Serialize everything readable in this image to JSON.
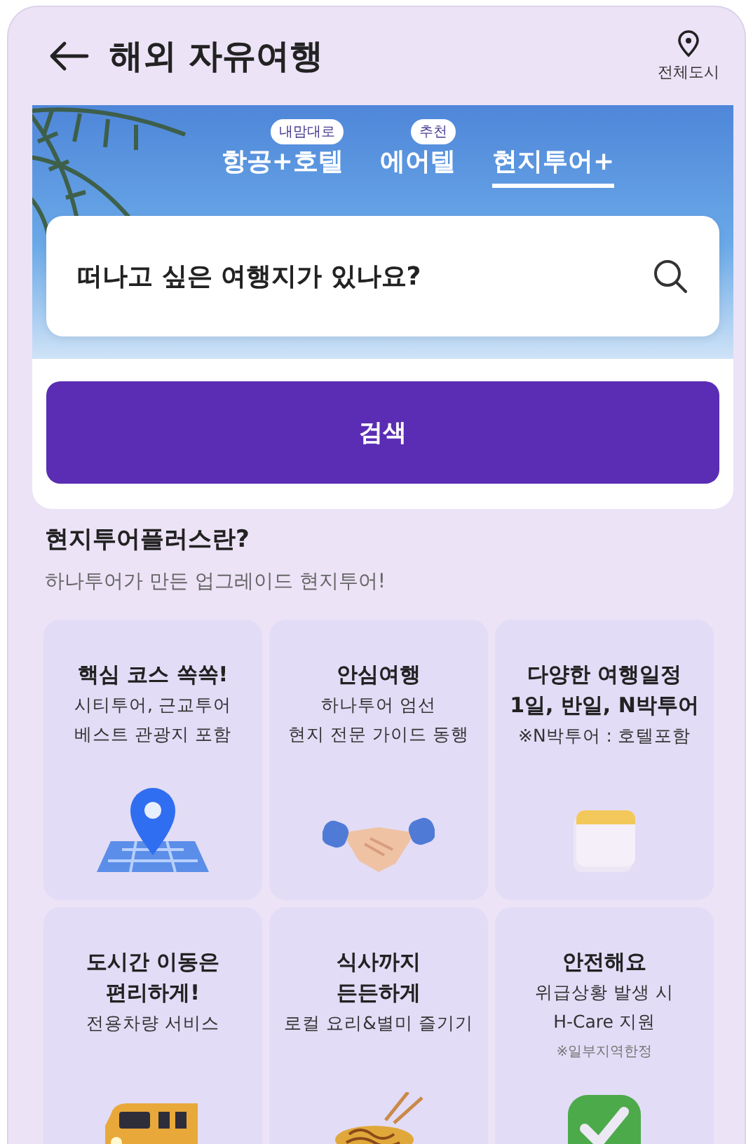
{
  "header": {
    "title": "해외 자유여행",
    "location_label": "전체도시"
  },
  "tabs": [
    {
      "label": "항공+호텔",
      "badge": "내맘대로",
      "selected": false
    },
    {
      "label": "에어텔",
      "badge": "추천",
      "selected": false
    },
    {
      "label": "현지투어+",
      "selected": true
    }
  ],
  "search": {
    "placeholder": "떠나고 싶은 여행지가 있나요?",
    "button": "검색"
  },
  "intro": {
    "title": "현지투어플러스란?",
    "subtitle": "하나투어가 만든 업그레이드 현지투어!"
  },
  "features": [
    {
      "kind": "map-pin",
      "title": [
        "핵심 코스 쏙쏙!"
      ],
      "desc": [
        "시티투어, 근교투어",
        "베스트 관광지 포함"
      ]
    },
    {
      "kind": "handshake",
      "title": [
        "안심여행"
      ],
      "desc": [
        "하나투어 엄선",
        "현지 전문 가이드 동행"
      ]
    },
    {
      "kind": "calendar",
      "title": [
        "다양한 여행일정",
        "1일, 반일, N박투어"
      ],
      "desc": [
        "※N박투어 : 호텔포함"
      ]
    },
    {
      "kind": "bus",
      "title": [
        "도시간 이동은",
        "편리하게!"
      ],
      "desc": [
        "전용차량 서비스"
      ]
    },
    {
      "kind": "noodles",
      "title": [
        "식사까지",
        "든든하게"
      ],
      "desc": [
        "로컬 요리&별미 즐기기"
      ]
    },
    {
      "kind": "check",
      "title": [
        "안전해요"
      ],
      "desc": [
        "위급상황 발생 시",
        "H-Care 지원"
      ],
      "note": "※일부지역한정"
    }
  ]
}
